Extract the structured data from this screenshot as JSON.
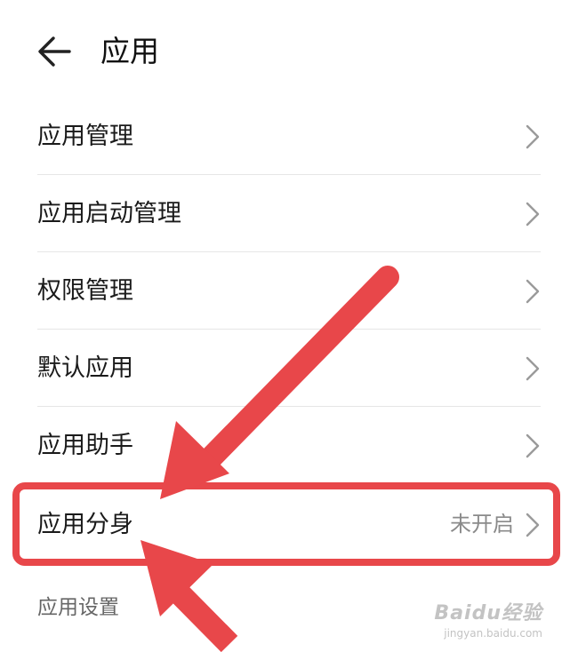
{
  "header": {
    "title": "应用"
  },
  "settings_list": [
    {
      "label": "应用管理"
    },
    {
      "label": "应用启动管理"
    },
    {
      "label": "权限管理"
    },
    {
      "label": "默认应用"
    },
    {
      "label": "应用助手"
    },
    {
      "label": "应用分身",
      "value": "未开启"
    }
  ],
  "section": {
    "title": "应用设置"
  },
  "annotation": {
    "color": "#e8474a"
  },
  "watermark": {
    "logo": "Baidu经验",
    "url": "jingyan.baidu.com"
  },
  "icons": {
    "back": "arrow-left-icon",
    "chevron": "chevron-right-icon"
  }
}
